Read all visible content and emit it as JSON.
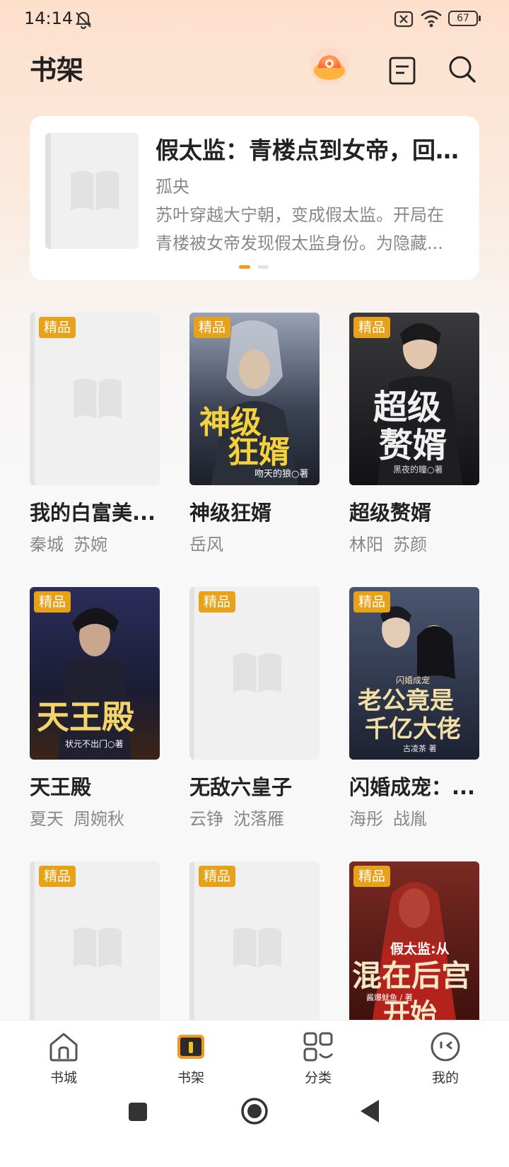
{
  "status": {
    "time": "14:14",
    "battery": "67",
    "icons": [
      "bell-muted-icon",
      "sim-off-icon",
      "wifi-icon",
      "battery-icon"
    ]
  },
  "header": {
    "title": "书架",
    "icons": [
      "hongbao-icon",
      "notes-icon",
      "search-icon"
    ]
  },
  "banner": {
    "title": "假太监：青楼点到女帝，回...",
    "author": "孤央",
    "description": "苏叶穿越大宁朝，变成假太监。开局在青楼被女帝发现假太监身份。为隐藏..."
  },
  "badge_label": "精品",
  "books": [
    {
      "title": "我的白富美...",
      "authors": [
        "秦城",
        "苏婉"
      ]
    },
    {
      "title": "神级狂婿",
      "authors": [
        "岳风"
      ]
    },
    {
      "title": "超级赘婿",
      "authors": [
        "林阳",
        "苏颜"
      ]
    },
    {
      "title": "天王殿",
      "authors": [
        "夏天",
        "周婉秋"
      ]
    },
    {
      "title": "无敌六皇子",
      "authors": [
        "云铮",
        "沈落雁"
      ]
    },
    {
      "title": "闪婚成宠：...",
      "authors": [
        "海彤",
        "战胤"
      ]
    },
    {
      "title": "",
      "authors": []
    },
    {
      "title": "",
      "authors": []
    },
    {
      "title": "",
      "authors": []
    }
  ],
  "covers": {
    "b2": {
      "big": "神级",
      "big2": "狂婿",
      "sub": "吻天的狼○著"
    },
    "b3": {
      "big": "超级",
      "big2": "赘婿",
      "sub": "黑夜的瞳○著"
    },
    "b4": {
      "big": "天王殿",
      "sub": "状元不出门○著"
    },
    "b6": {
      "tag": "闪婚成宠",
      "big": "老公竟是",
      "big2": "千亿大佬",
      "sub": "古凌茶 著"
    },
    "b9": {
      "top": "假太监:从",
      "big": "混在后宫",
      "big2": "开始",
      "sub": "酱爆鱿鱼 / 著"
    }
  },
  "nav": {
    "items": [
      {
        "label": "书城",
        "icon": "home-icon"
      },
      {
        "label": "书架",
        "icon": "bookshelf-icon",
        "active": true
      },
      {
        "label": "分类",
        "icon": "category-icon"
      },
      {
        "label": "我的",
        "icon": "profile-icon"
      }
    ]
  },
  "system_nav": [
    "recents-icon",
    "home-button-icon",
    "back-icon"
  ],
  "colors": {
    "accent": "#f39a1e",
    "badge": "#e8a21a",
    "header_gradient": "#fde0cc"
  }
}
